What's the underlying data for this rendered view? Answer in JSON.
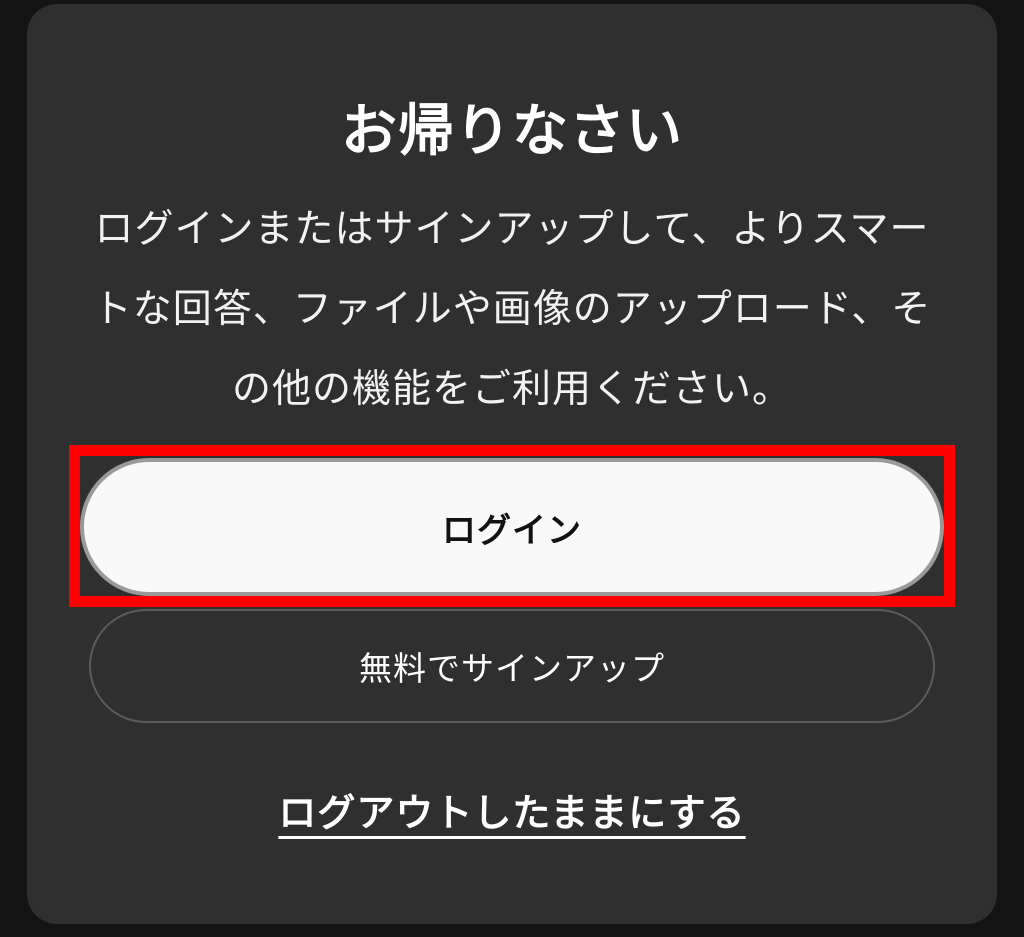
{
  "dialog": {
    "title": "お帰りなさい",
    "description": "ログインまたはサインアップして、よりスマートな回答、ファイルや画像のアップロード、その他の機能をご利用ください。",
    "login_label": "ログイン",
    "signup_label": "無料でサインアップ",
    "stay_logged_out_label": "ログアウトしたままにする"
  },
  "colors": {
    "modal_background": "#2f2f2f",
    "login_button_background": "#f9f9f9",
    "highlight_border": "#ff0000"
  }
}
